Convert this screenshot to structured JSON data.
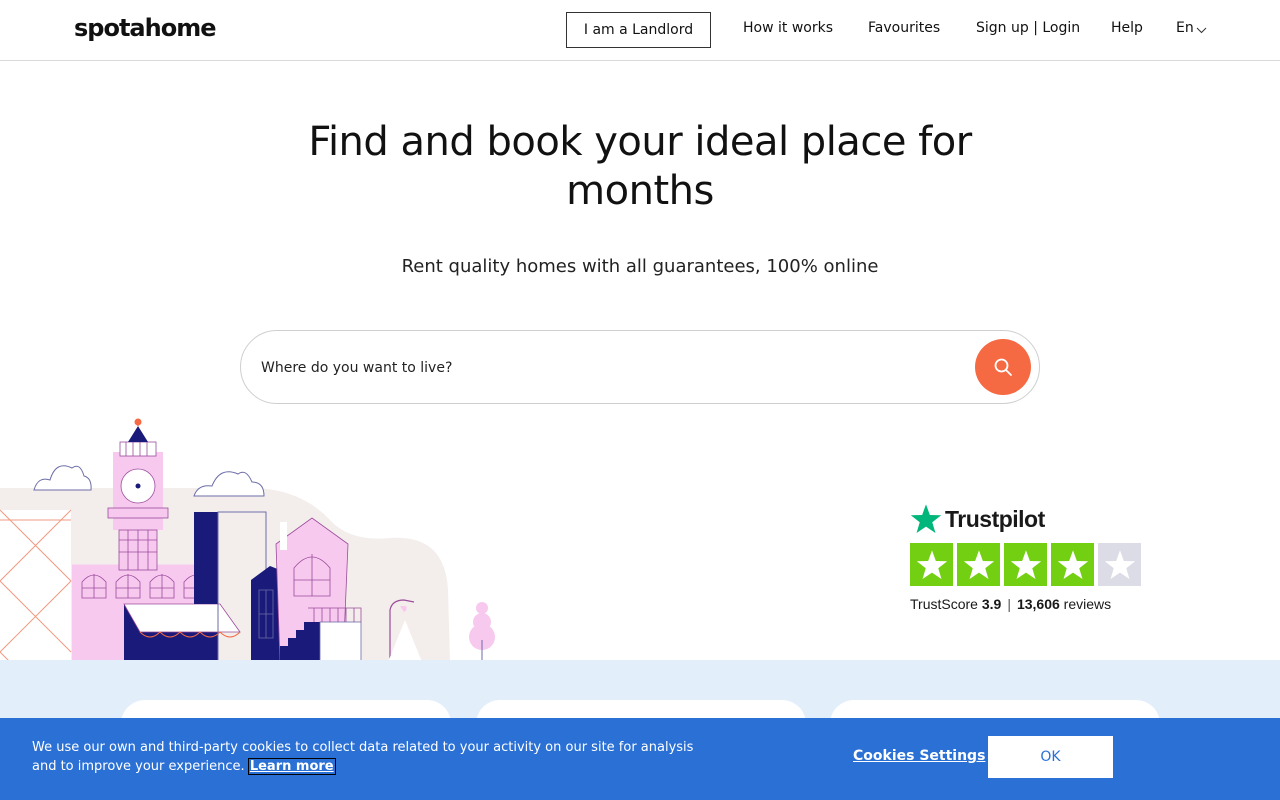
{
  "header": {
    "logo": "spotahome",
    "landlord_label": "I am a Landlord",
    "nav": [
      "How it works",
      "Favourites",
      "Sign up | Login",
      "Help"
    ],
    "language": "En"
  },
  "hero": {
    "title": "Find and book your ideal place for months",
    "subtitle": "Rent quality homes with all guarantees, 100% online"
  },
  "search": {
    "placeholder": "Where do you want to live?",
    "button_icon": "search-icon"
  },
  "trustpilot": {
    "brand": "Trustpilot",
    "rating_stars_filled": 4,
    "rating_stars_total": 5,
    "score_label": "TrustScore",
    "score": "3.9",
    "separator": "|",
    "reviews_count": "13,606",
    "reviews_label": "reviews"
  },
  "cookie_banner": {
    "text": "We use our own and third-party cookies to collect data related to your activity on our site for analysis and to improve your experience.",
    "learn_more": "Learn more",
    "settings_label": "Cookies Settings",
    "ok_label": "OK"
  },
  "colors": {
    "accent": "#f56a43",
    "cookie_bg": "#2a70d5",
    "band_bg": "#e3eefb",
    "trustpilot_green": "#73cf11",
    "trustpilot_brand": "#00b67a"
  }
}
